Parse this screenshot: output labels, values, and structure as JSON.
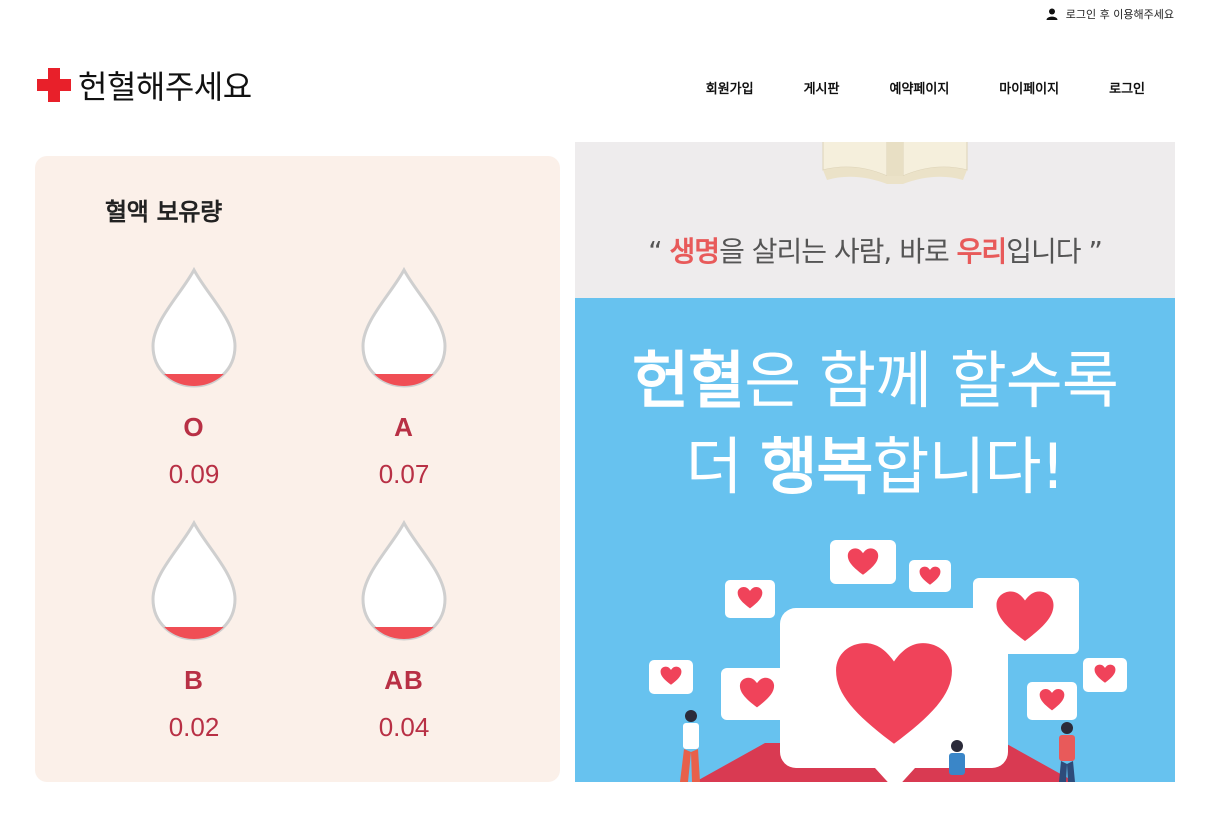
{
  "header": {
    "util_link": "로그인 후 이용해주세요",
    "logo_text": "헌혈해주세요",
    "nav": [
      "회원가입",
      "게시판",
      "예약페이지",
      "마이페이지",
      "로그인"
    ]
  },
  "blood_stock": {
    "title": "혈액 보유량",
    "types": [
      {
        "type": "O",
        "value": "0.09"
      },
      {
        "type": "A",
        "value": "0.07"
      },
      {
        "type": "B",
        "value": "0.02"
      },
      {
        "type": "AB",
        "value": "0.04"
      }
    ]
  },
  "banner": {
    "quote_open": "“ ",
    "quote_accent1": "생명",
    "quote_mid": "을 살리는 사람, 바로 ",
    "quote_accent2": "우리",
    "quote_end": "입니다 ”",
    "line1_bold": "헌혈",
    "line1_rest": "은 함께 할수록",
    "line2_pre": "더 ",
    "line2_bold": "행복",
    "line2_rest": "합니다!"
  },
  "colors": {
    "accent_red": "#e8202a",
    "blood_text": "#b83045",
    "panel_bg": "#fbf0e9",
    "banner_blue": "#67c2ef",
    "heart_red": "#f0435a"
  },
  "icons": [
    "user-icon",
    "red-cross-logo-icon",
    "blood-drop-icon",
    "heart-icon"
  ]
}
